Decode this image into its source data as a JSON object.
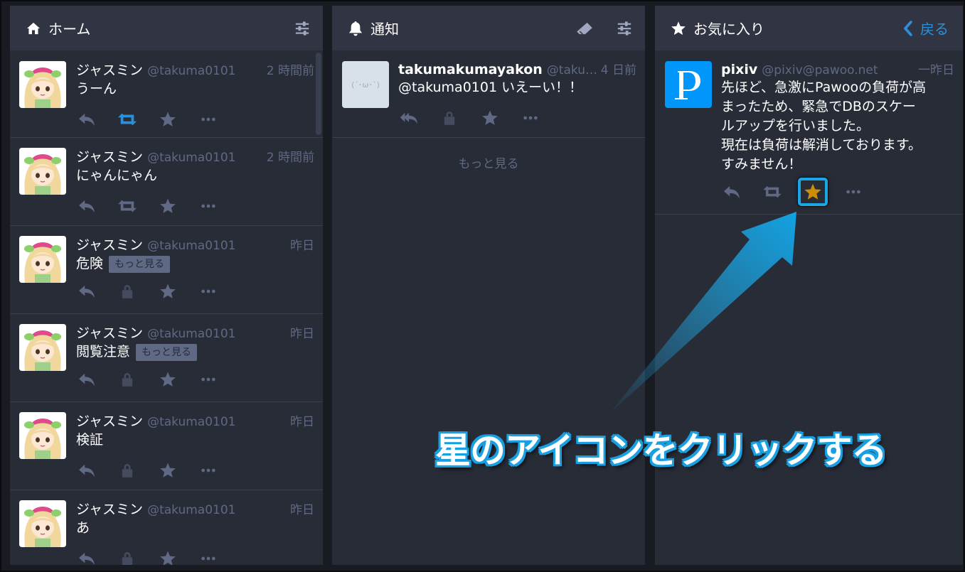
{
  "columns": {
    "home": {
      "title": "ホーム",
      "statuses": [
        {
          "display_name": "ジャスミン",
          "acct": "@takuma0101",
          "time": "2 時間前",
          "content": "うーん",
          "cw_label": "",
          "boost_active": true,
          "private": false
        },
        {
          "display_name": "ジャスミン",
          "acct": "@takuma0101",
          "time": "2 時間前",
          "content": "にゃんにゃん",
          "cw_label": "",
          "boost_active": false,
          "private": false
        },
        {
          "display_name": "ジャスミン",
          "acct": "@takuma0101",
          "time": "昨日",
          "content": "危険",
          "cw_label": "もっと見る",
          "boost_active": false,
          "private": true
        },
        {
          "display_name": "ジャスミン",
          "acct": "@takuma0101",
          "time": "昨日",
          "content": "閲覧注意",
          "cw_label": "もっと見る",
          "boost_active": false,
          "private": true
        },
        {
          "display_name": "ジャスミン",
          "acct": "@takuma0101",
          "time": "昨日",
          "content": "検証",
          "cw_label": "",
          "boost_active": false,
          "private": true
        },
        {
          "display_name": "ジャスミン",
          "acct": "@takuma0101",
          "time": "昨日",
          "content": "あ",
          "cw_label": "",
          "boost_active": false,
          "private": true
        }
      ]
    },
    "notifications": {
      "title": "通知",
      "status": {
        "display_name": "takumakumayakon",
        "acct": "@takum...",
        "time": "4 日前",
        "content": "@takuma0101 いえーい！！",
        "avatar_text": "(´･ω･`)"
      },
      "load_more": "もっと見る"
    },
    "favourites": {
      "title": "お気に入り",
      "back_label": "戻る",
      "status": {
        "display_name": "pixiv",
        "acct": "@pixiv@pawoo.net",
        "time": "一昨日",
        "content_lines": [
          "先ほど、急激にPawooの負荷が高",
          "まったため、緊急でDBのスケー",
          "ルアップを行いました。",
          "現在は負荷は解消しております。",
          "すみません！"
        ],
        "favourited": true
      }
    }
  },
  "annotation": {
    "text": "星のアイコンをクリックする"
  },
  "colors": {
    "background": "#191b22",
    "column": "#282c37",
    "header": "#313543",
    "muted": "#606984",
    "accent": "#2b90d9",
    "highlight": "#19a7e6",
    "star_active": "#ca8f04"
  },
  "icons": {
    "home_header": "home-icon",
    "notif_header": "bell-icon",
    "fav_header": "star-icon",
    "settings": "sliders-icon",
    "clear": "eraser-icon",
    "reply": "reply-icon",
    "reply_all": "reply-all-icon",
    "boost": "retweet-icon",
    "lock": "lock-icon",
    "favourite": "star-icon",
    "more": "ellipsis-icon",
    "back": "chevron-left-icon"
  }
}
